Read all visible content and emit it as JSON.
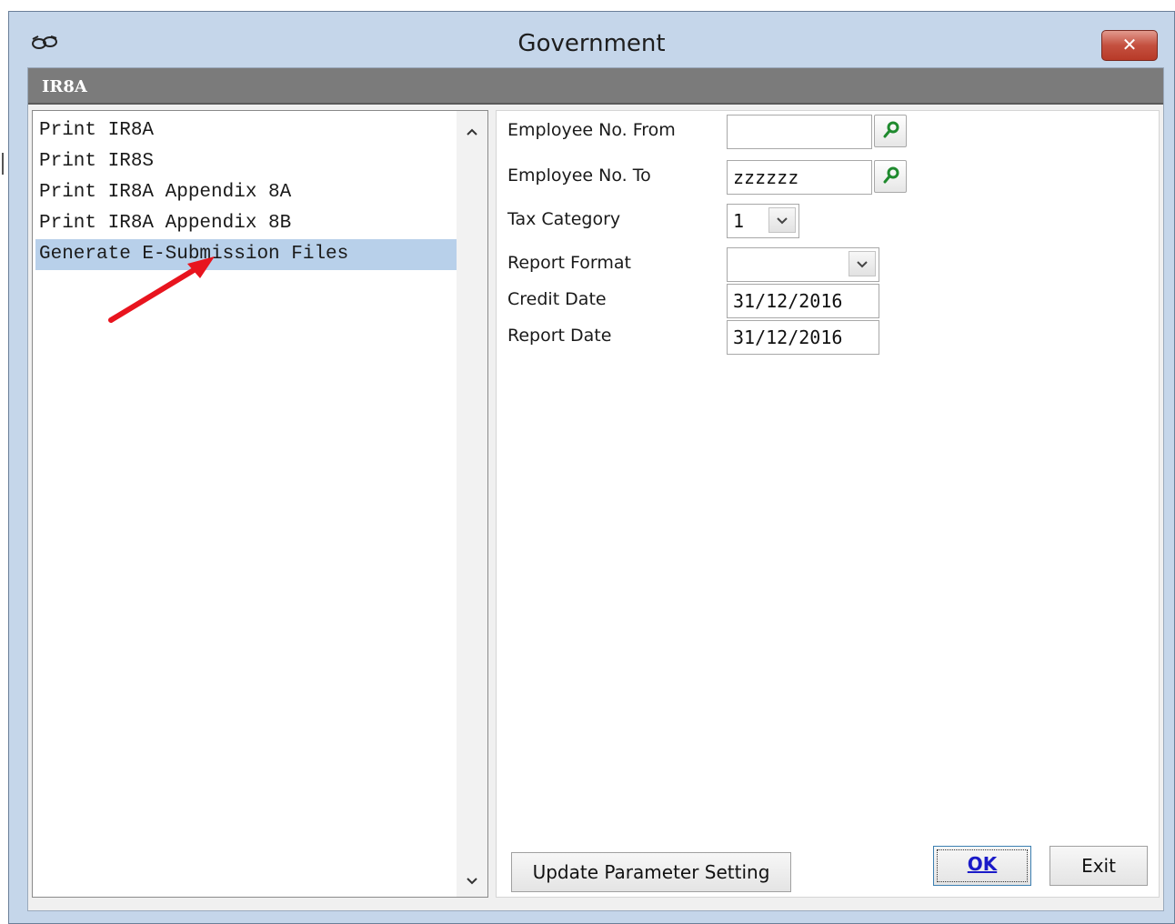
{
  "window": {
    "title": "Government",
    "close_label": "✕"
  },
  "section": {
    "title": "IR8A"
  },
  "menu": {
    "items": [
      {
        "label": "Print IR8A"
      },
      {
        "label": "Print IR8S"
      },
      {
        "label": "Print IR8A Appendix 8A"
      },
      {
        "label": "Print IR8A Appendix 8B"
      },
      {
        "label": "Generate E-Submission Files"
      }
    ],
    "selected_index": 4
  },
  "form": {
    "employee_from_label": "Employee No. From",
    "employee_from_value": "",
    "employee_to_label": "Employee No. To",
    "employee_to_value": "zzzzzz",
    "tax_category_label": "Tax Category",
    "tax_category_value": "1",
    "report_format_label": "Report Format",
    "report_format_value": "",
    "credit_date_label": "Credit Date",
    "credit_date_value": "31/12/2016",
    "report_date_label": "Report Date",
    "report_date_value": "31/12/2016"
  },
  "buttons": {
    "update_parameter": "Update Parameter Setting",
    "ok": "OK",
    "exit": "Exit"
  },
  "colors": {
    "selection": "#b8d0ea",
    "header": "#7b7b7b",
    "annotation_arrow": "#e8141e",
    "lookup_icon": "#1f8a2e"
  },
  "icons": {
    "title": "glasses-icon",
    "lookup": "magnifier-icon",
    "dropdown": "chevron-down-icon"
  }
}
